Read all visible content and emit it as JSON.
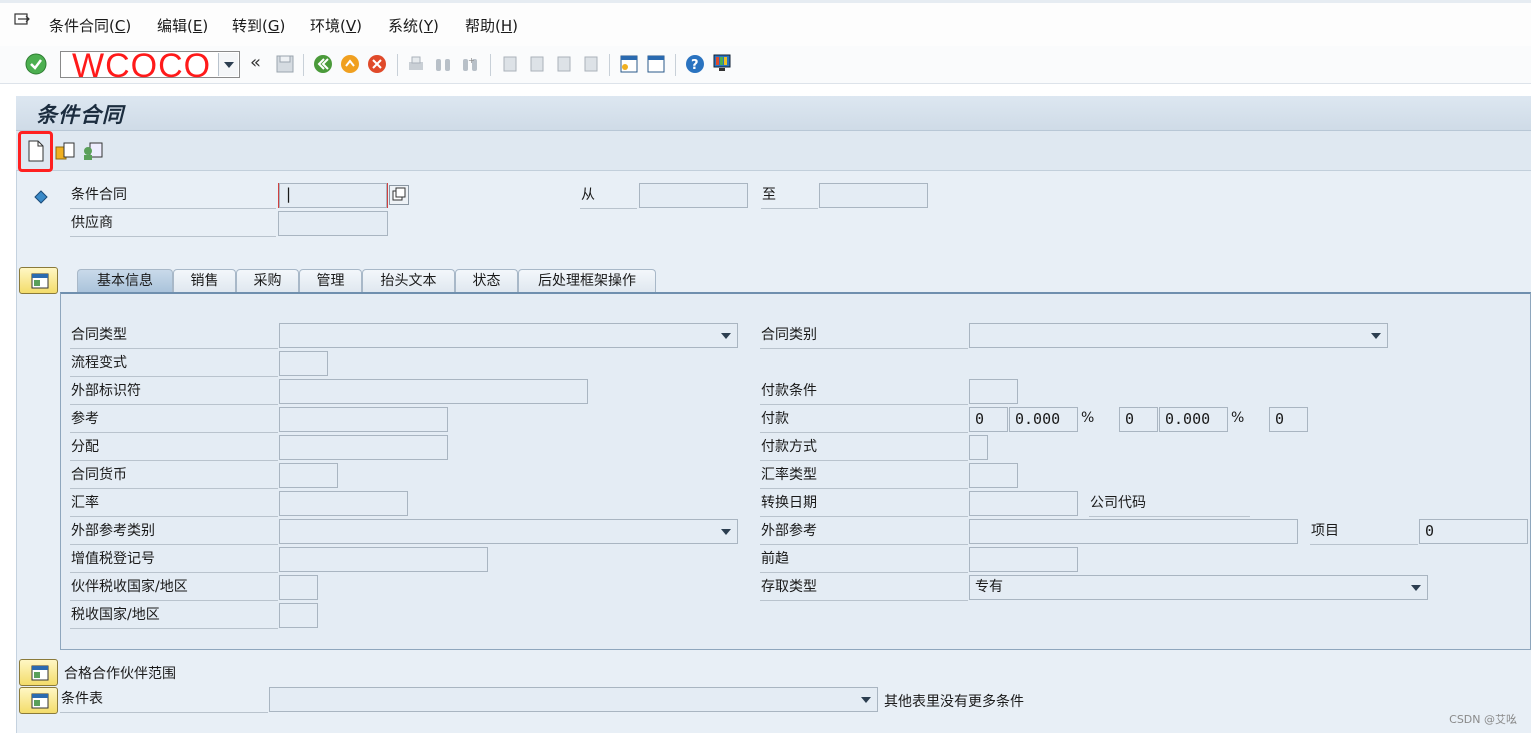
{
  "menu": {
    "items": [
      {
        "label": "条件合同(",
        "key": "C",
        "end": ")"
      },
      {
        "label": "编辑(",
        "key": "E",
        "end": ")"
      },
      {
        "label": "转到(",
        "key": "G",
        "end": ")"
      },
      {
        "label": "环境(",
        "key": "V",
        "end": ")"
      },
      {
        "label": "系统(",
        "key": "Y",
        "end": ")"
      },
      {
        "label": "帮助(",
        "key": "H",
        "end": ")"
      }
    ]
  },
  "toolbar": {
    "command_value": "WCOCO"
  },
  "page": {
    "title": "条件合同"
  },
  "header": {
    "contract_label": "条件合同",
    "contract_value": "|",
    "vendor_label": "供应商",
    "from_label": "从",
    "to_label": "至"
  },
  "tabs": [
    {
      "label": "基本信息",
      "active": true
    },
    {
      "label": "销售",
      "active": false
    },
    {
      "label": "采购",
      "active": false
    },
    {
      "label": "管理",
      "active": false
    },
    {
      "label": "抬头文本",
      "active": false
    },
    {
      "label": "状态",
      "active": false
    },
    {
      "label": "后处理框架操作",
      "active": false
    }
  ],
  "basic": {
    "contract_type_label": "合同类型",
    "process_variant_label": "流程变式",
    "external_id_label": "外部标识符",
    "reference_label": "参考",
    "assignment_label": "分配",
    "currency_label": "合同货币",
    "exchange_rate_label": "汇率",
    "ext_ref_type_label": "外部参考类别",
    "vat_reg_label": "增值税登记号",
    "partner_tax_country_label": "伙伴税收国家/地区",
    "tax_country_label": "税收国家/地区",
    "contract_category_label": "合同类别",
    "payment_terms_label": "付款条件",
    "payment_label": "付款",
    "payment_day1": "0",
    "payment_pct1": "0.000",
    "pct_sign1": "%",
    "payment_day2": "0",
    "payment_pct2": "0.000",
    "pct_sign2": "%",
    "payment_day3": "0",
    "payment_method_label": "付款方式",
    "rate_type_label": "汇率类型",
    "conversion_date_label": "转换日期",
    "company_code_label": "公司代码",
    "ext_reference_label": "外部参考",
    "item_label": "项目",
    "item_value": "0",
    "predecessor_label": "前趋",
    "access_type_label": "存取类型",
    "access_type_value": "专有"
  },
  "footer": {
    "partner_scope_label": "合格合作伙伴范围",
    "condition_table_label": "条件表",
    "no_more_conditions": "其他表里没有更多条件",
    "credit": "CSDN @艾吆"
  },
  "colors": {
    "accent_red": "#ff1a1a",
    "frame_bg": "#e8eff6",
    "active_tab": "#a9c2da"
  }
}
